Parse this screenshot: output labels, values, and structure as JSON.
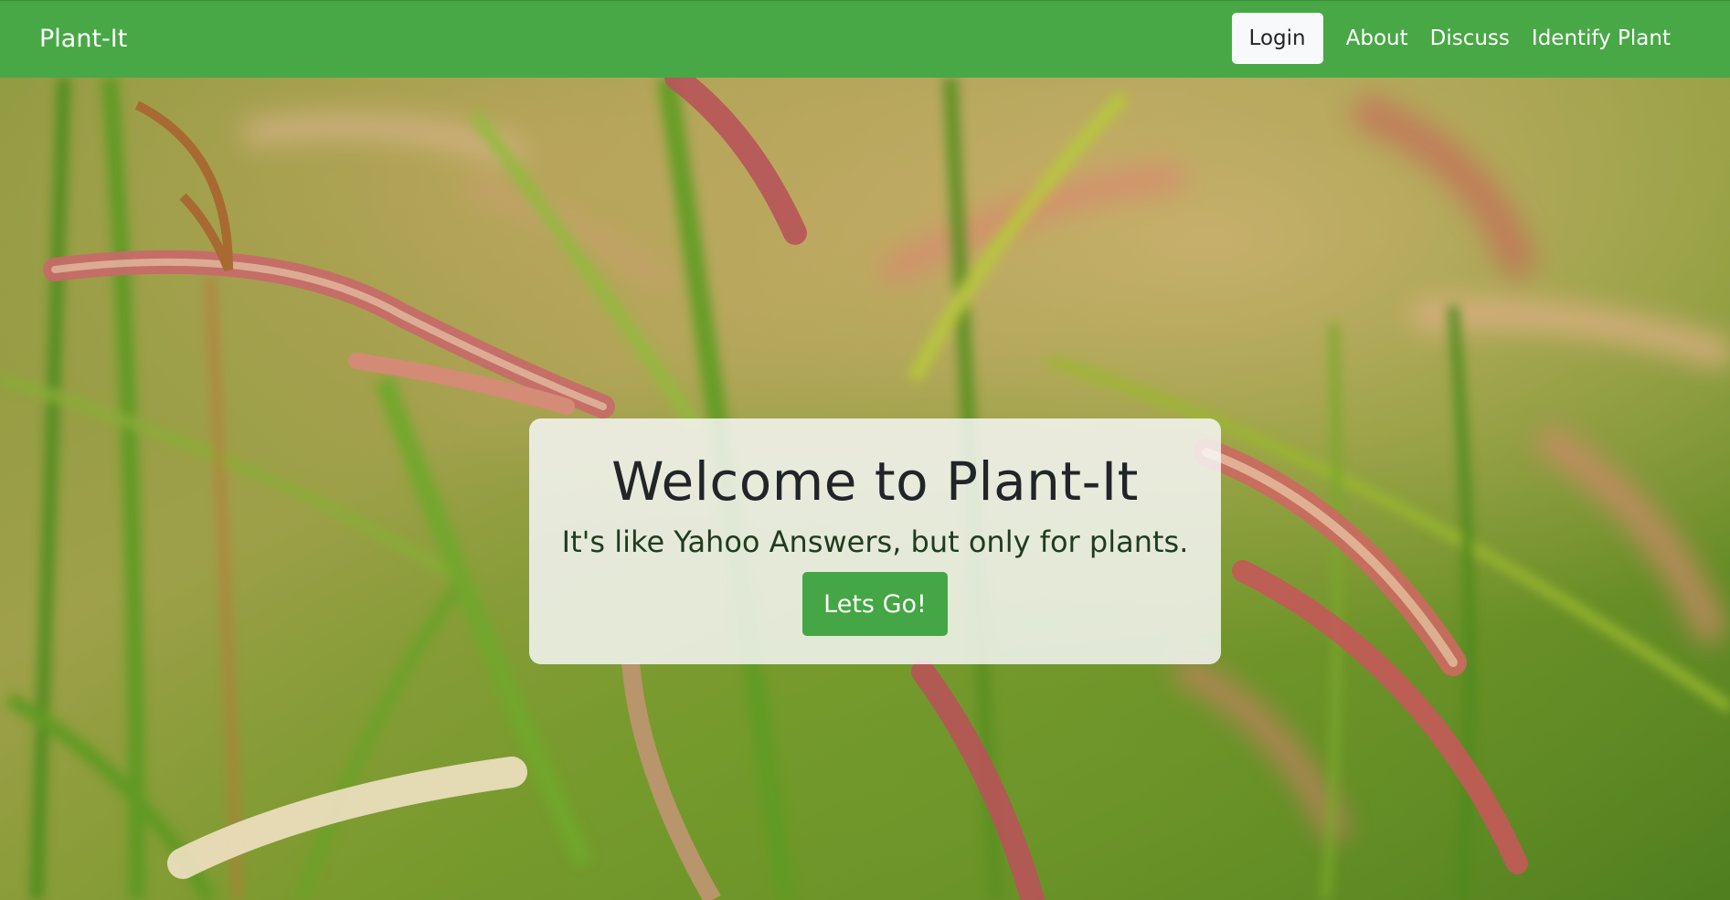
{
  "navbar": {
    "brand": "Plant-It",
    "login_label": "Login",
    "links": {
      "about": "About",
      "discuss": "Discuss",
      "identify": "Identify Plant"
    }
  },
  "hero": {
    "background": "photo of grass with pink feathery seed heads",
    "title": "Welcome to Plant-It",
    "subtitle": "It's like Yahoo Answers, but only for plants.",
    "cta_label": "Lets Go!"
  },
  "colors": {
    "navbar_bg": "#48a846",
    "button_green": "#44a644",
    "login_bg": "#f8f9fa",
    "title_text": "#212529",
    "subtitle_text": "#1e3d1e"
  }
}
